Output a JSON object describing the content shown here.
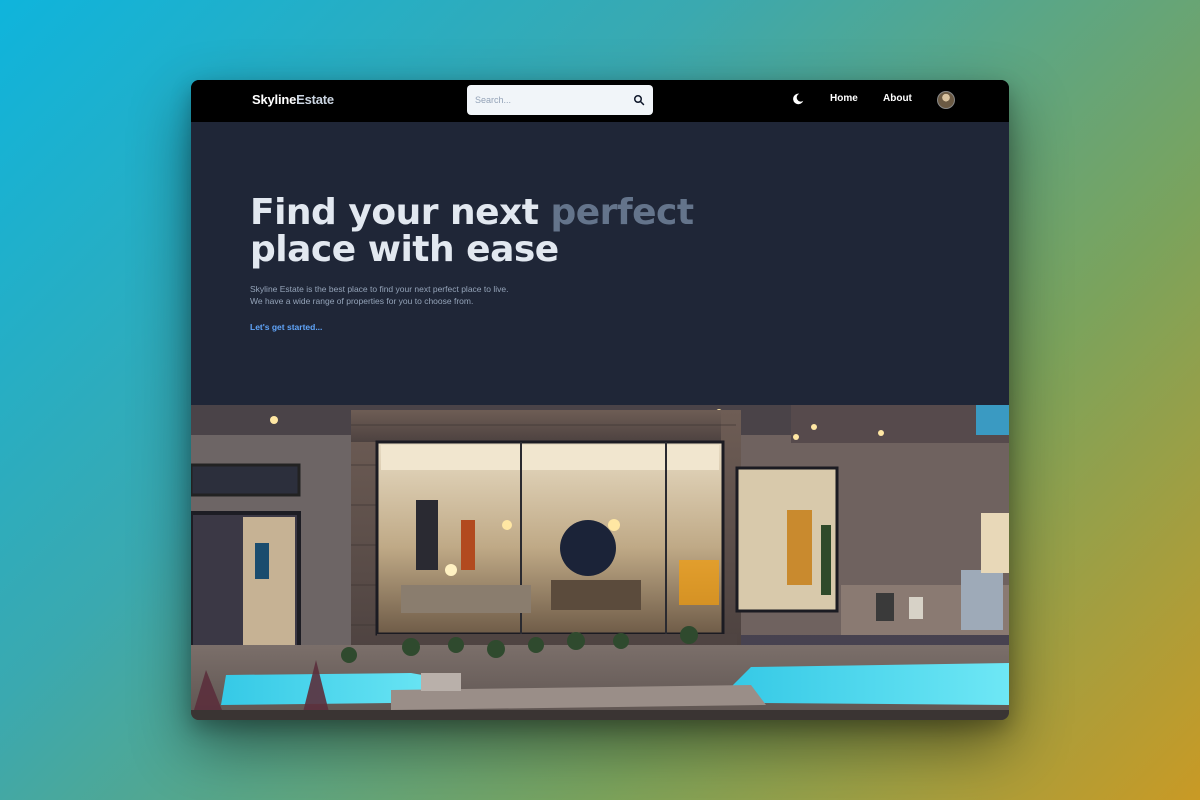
{
  "navbar": {
    "logo_part1": "Skyline",
    "logo_part2": "Estate",
    "search_placeholder": "Search...",
    "search_icon": "search-icon",
    "theme_icon": "moon-icon",
    "links": [
      {
        "label": "Home"
      },
      {
        "label": "About"
      }
    ],
    "avatar_icon": "avatar"
  },
  "hero": {
    "title_line1_a": "Find your next ",
    "title_line1_b": "perfect",
    "title_line2": "place with ease",
    "description_line1": "Skyline Estate is the best place to find your next perfect place to live.",
    "description_line2": "We have a wide range of properties for you to choose from.",
    "cta_label": "Let's get started..."
  },
  "colors": {
    "background": "#1f2637",
    "navbar": "#000000",
    "accent": "#60a5fa",
    "muted": "#64748b"
  }
}
